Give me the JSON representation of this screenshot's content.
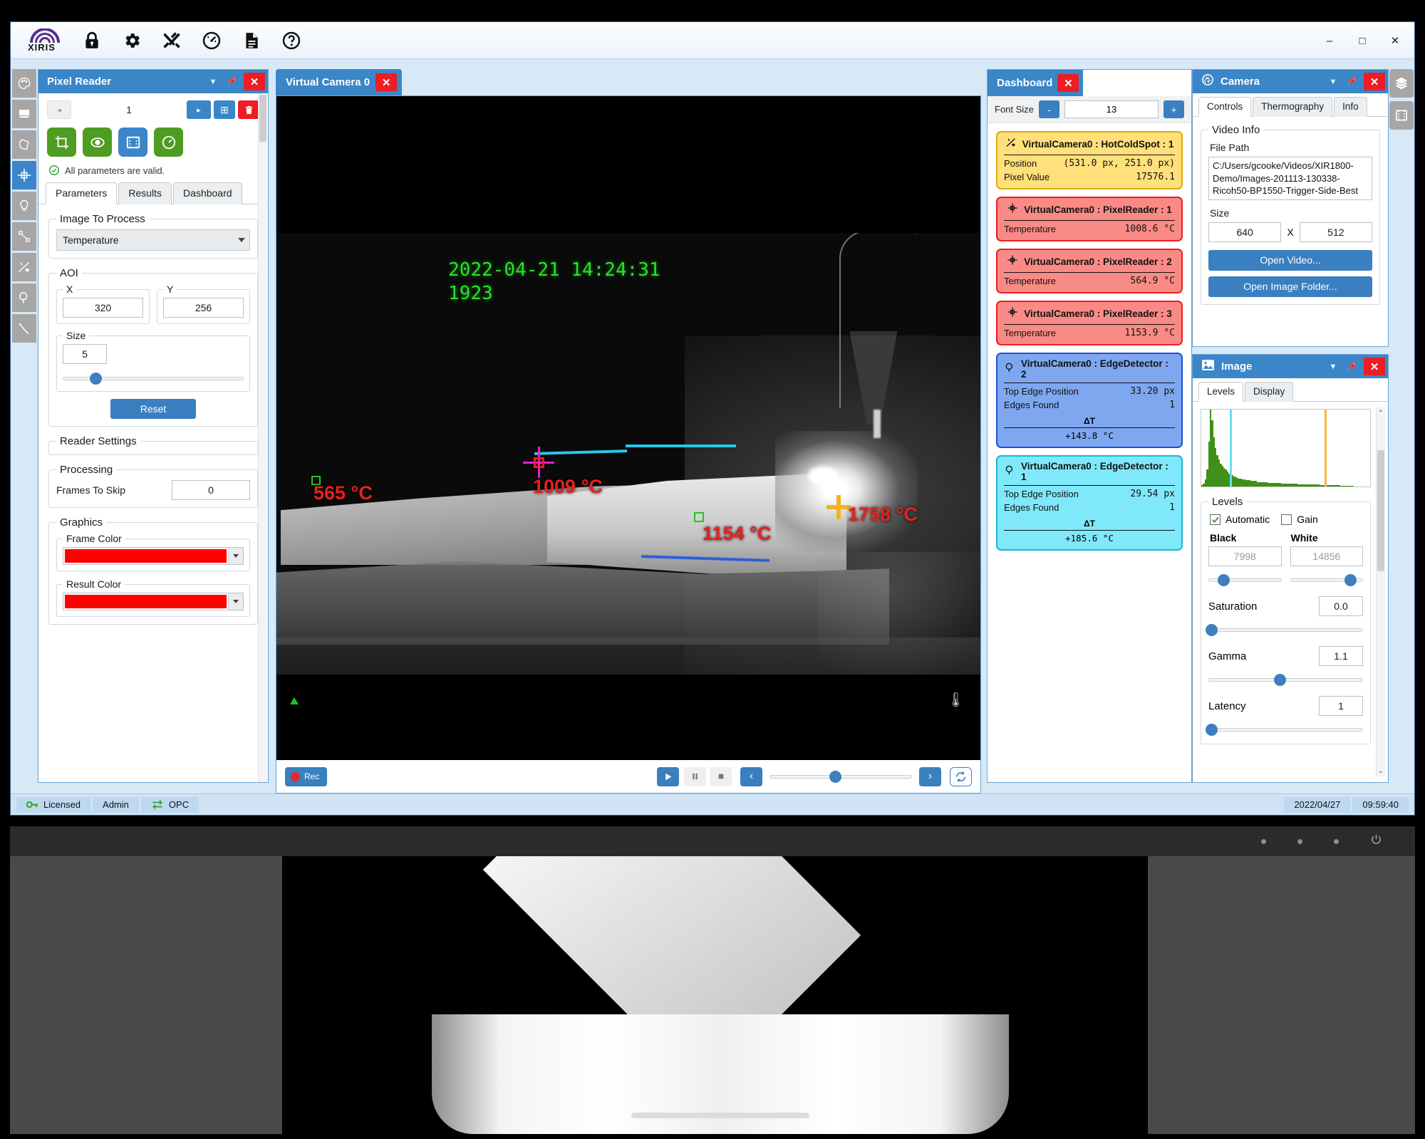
{
  "window": {
    "title": "",
    "brand": "XIRIS",
    "toolbar": [
      {
        "name": "lock-icon",
        "label": "Lock"
      },
      {
        "name": "gear-icon",
        "label": "Settings"
      },
      {
        "name": "tools-icon",
        "label": "Tools"
      },
      {
        "name": "gauge-icon",
        "label": "Performance"
      },
      {
        "name": "document-icon",
        "label": "Reports"
      },
      {
        "name": "help-icon",
        "label": "Help"
      }
    ],
    "controls": {
      "minimize": "–",
      "maximize": "□",
      "close": "✕"
    }
  },
  "rail": {
    "items": [
      {
        "name": "palette-icon",
        "label": "Palette"
      },
      {
        "name": "book-icon",
        "label": "Library"
      },
      {
        "name": "blob-icon",
        "label": "Blob"
      },
      {
        "name": "crosshair-icon",
        "label": "Pixel Reader",
        "active": true
      },
      {
        "name": "bulb-icon",
        "label": "Light"
      },
      {
        "name": "measure-icon",
        "label": "Measure"
      },
      {
        "name": "hotcoldspot-icon",
        "label": "Hot Cold Spot"
      },
      {
        "name": "magnifier-icon",
        "label": "Edge Detector"
      },
      {
        "name": "wrench-icon",
        "label": "Tools"
      }
    ],
    "right_items": [
      {
        "name": "layers-icon",
        "label": "Layers"
      },
      {
        "name": "film-icon",
        "label": "Film"
      }
    ]
  },
  "pixel_reader": {
    "title": "Pixel Reader",
    "nav": {
      "prev": "◂",
      "index": "1",
      "next": "▸",
      "add": "⊞",
      "delete": "🗑"
    },
    "tools": [
      {
        "name": "crop-tool-icon",
        "label": "Crop"
      },
      {
        "name": "eye-tool-icon",
        "label": "Visibility"
      },
      {
        "name": "film-tool-icon",
        "label": "Film",
        "selected": true
      },
      {
        "name": "gauge-tool-icon",
        "label": "Gauge"
      }
    ],
    "validation": "All parameters are valid.",
    "tabs": [
      {
        "label": "Parameters",
        "selected": true
      },
      {
        "label": "Results",
        "selected": false
      },
      {
        "label": "Dashboard",
        "selected": false
      }
    ],
    "image_to_process": {
      "legend": "Image To Process",
      "value": "Temperature"
    },
    "aoi": {
      "legend": "AOI",
      "x_label": "X",
      "x_value": "320",
      "y_label": "Y",
      "y_value": "256",
      "size_legend": "Size",
      "size_value": "5",
      "size_pct": 18
    },
    "reset_label": "Reset",
    "reader_settings_legend": "Reader Settings",
    "processing": {
      "legend": "Processing",
      "frames_to_skip_label": "Frames To Skip",
      "frames_to_skip_value": "0"
    },
    "graphics": {
      "legend": "Graphics",
      "frame_color_label": "Frame Color",
      "frame_color": "#fe0000",
      "result_color_label": "Result Color",
      "result_color": "#fe0000"
    }
  },
  "viewport": {
    "tab_label": "Virtual Camera 0",
    "overlay_timestamp": "2022-04-21 14:24:31",
    "overlay_frame": "1923",
    "annotations": [
      {
        "name": "temp-label-565",
        "text": "565 °C",
        "marker": "green-square"
      },
      {
        "name": "temp-label-1009",
        "text": "1009 °C",
        "marker": "magenta-crosshair"
      },
      {
        "name": "temp-label-1154",
        "text": "1154 °C",
        "marker": "green-square"
      },
      {
        "name": "temp-label-1758",
        "text": "1758 °C",
        "marker": "yellow-cross"
      }
    ],
    "controls": {
      "rec": "Rec",
      "play": "▶",
      "pause": "❙❙",
      "stop": "■",
      "step_back": "‹",
      "step_fwd": "›",
      "loop": "⟳",
      "seek_pct": 46
    }
  },
  "dashboard": {
    "title": "Dashboard",
    "font_size_label": "Font Size",
    "font_size_minus": "-",
    "font_size_value": "13",
    "font_size_plus": "+",
    "cards": [
      {
        "icon": "hotcoldspot-icon",
        "title": "VirtualCamera0 : HotColdSpot : 1",
        "bg": "#ffe07a",
        "border": "#e0a800",
        "rows": [
          {
            "k": "Position",
            "v": "(531.0 px, 251.0 px)"
          },
          {
            "k": "Pixel Value",
            "v": "17576.1"
          }
        ]
      },
      {
        "icon": "crosshair-icon",
        "title": "VirtualCamera0 : PixelReader : 1",
        "bg": "#fa8a85",
        "border": "#ee1c23",
        "rows": [
          {
            "k": "Temperature",
            "v": "1008.6 °C"
          }
        ]
      },
      {
        "icon": "crosshair-icon",
        "title": "VirtualCamera0 : PixelReader : 2",
        "bg": "#fa8a85",
        "border": "#ee1c23",
        "rows": [
          {
            "k": "Temperature",
            "v": "564.9 °C"
          }
        ]
      },
      {
        "icon": "crosshair-icon",
        "title": "VirtualCamera0 : PixelReader : 3",
        "bg": "#fa8a85",
        "border": "#ee1c23",
        "rows": [
          {
            "k": "Temperature",
            "v": "1153.9 °C"
          }
        ]
      },
      {
        "icon": "magnifier-icon",
        "title": "VirtualCamera0 : EdgeDetector : 2",
        "bg": "#7ea7f0",
        "border": "#1f4fd8",
        "rows": [
          {
            "k": "Top Edge Position",
            "v": "33.20 px"
          },
          {
            "k": "Edges Found",
            "v": "1"
          }
        ],
        "delta_label": "ΔT",
        "delta_value": "+143.8 °C"
      },
      {
        "icon": "magnifier-icon",
        "title": "VirtualCamera0 : EdgeDetector : 1",
        "bg": "#7fe9fb",
        "border": "#14b8d8",
        "rows": [
          {
            "k": "Top Edge Position",
            "v": "29.54 px"
          },
          {
            "k": "Edges Found",
            "v": "1"
          }
        ],
        "delta_label": "ΔT",
        "delta_value": "+185.6 °C"
      }
    ]
  },
  "camera": {
    "title": "Camera",
    "tabs": [
      {
        "label": "Controls",
        "selected": true
      },
      {
        "label": "Thermography",
        "selected": false
      },
      {
        "label": "Info",
        "selected": false
      }
    ],
    "video_info_legend": "Video Info",
    "file_path_label": "File Path",
    "file_path_value": "C:/Users/gcooke/Videos/XIR1800-Demo/Images-201113-130338-Ricoh50-BP1550-Trigger-Side-Best",
    "size_label": "Size",
    "size_width": "640",
    "size_x": "X",
    "size_height": "512",
    "open_video_label": "Open Video...",
    "open_image_folder_label": "Open Image Folder..."
  },
  "image_panel": {
    "title": "Image",
    "tabs": [
      {
        "label": "Levels",
        "selected": true
      },
      {
        "label": "Display",
        "selected": false
      }
    ],
    "histogram": {
      "black_marker_color": "#5fe3f2",
      "white_marker_color": "#f5b93c",
      "fill_color": "#3f8f18",
      "black_marker_pct": 17,
      "white_marker_pct": 73,
      "bins": [
        2,
        4,
        9,
        22,
        58,
        100,
        86,
        64,
        50,
        41,
        35,
        30,
        27,
        24,
        22,
        19,
        17,
        16,
        15,
        13,
        12,
        11,
        10,
        10,
        9,
        9,
        8,
        8,
        8,
        7,
        7,
        7,
        7,
        6,
        6,
        6,
        6,
        6,
        6,
        5,
        5,
        5,
        5,
        5,
        5,
        5,
        5,
        4,
        4,
        4,
        4,
        4,
        4,
        4,
        4,
        4,
        4,
        3,
        3,
        3,
        3,
        3,
        3,
        3,
        3,
        3,
        3,
        3,
        3,
        3,
        2,
        2,
        2,
        2,
        2,
        2,
        2,
        2,
        2,
        2,
        2,
        2,
        1,
        1,
        1,
        1,
        1,
        1,
        1,
        1,
        0,
        0,
        0,
        0,
        0,
        0,
        0,
        0,
        0,
        0
      ]
    },
    "levels_legend": "Levels",
    "automatic_label": "Automatic",
    "automatic_checked": true,
    "gain_label": "Gain",
    "gain_checked": false,
    "black_label": "Black",
    "black_value": "7998",
    "black_pct": 20,
    "white_label": "White",
    "white_value": "14856",
    "white_pct": 82,
    "saturation_label": "Saturation",
    "saturation_value": "0.0",
    "saturation_pct": 2,
    "gamma_label": "Gamma",
    "gamma_value": "1.1",
    "gamma_pct": 46,
    "latency_label": "Latency",
    "latency_value": "1",
    "latency_pct": 2
  },
  "status_bar": {
    "licensed": "Licensed",
    "admin": "Admin",
    "opc": "OPC",
    "date": "2022/04/27",
    "time": "09:59:40"
  }
}
